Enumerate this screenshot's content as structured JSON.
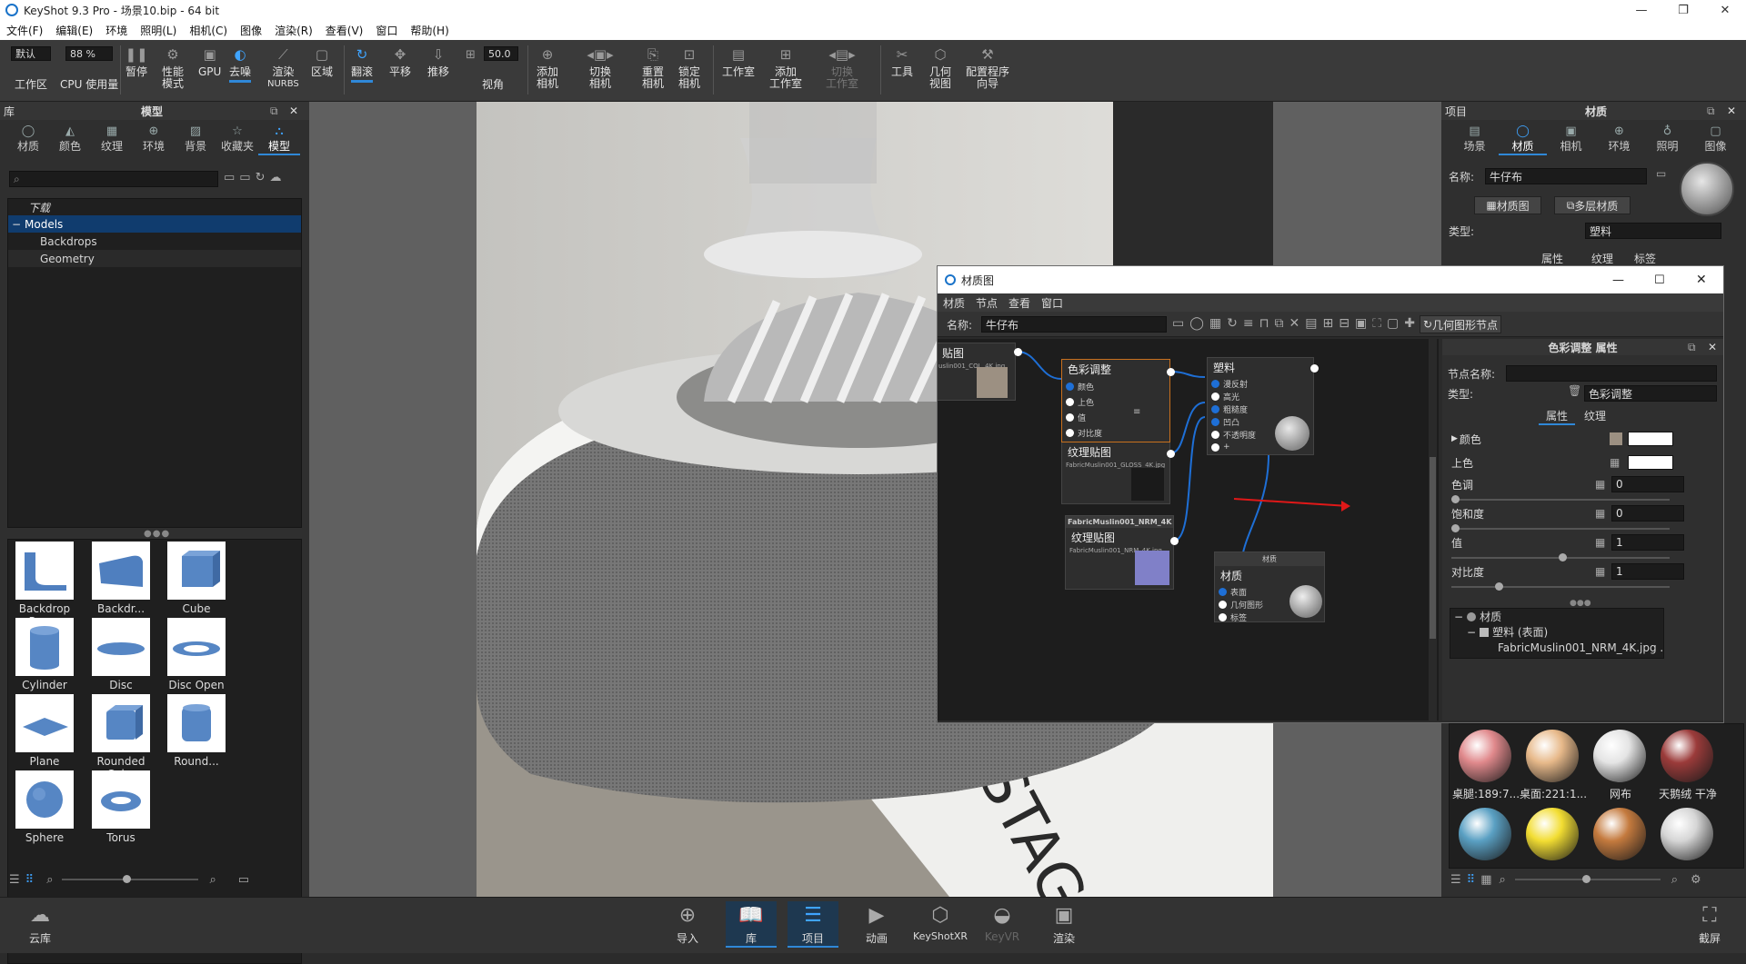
{
  "titlebar": {
    "title": "KeyShot 9.3 Pro  - 场景10.bip  - 64 bit",
    "min": "—",
    "restore": "❐",
    "close": "✕"
  },
  "menubar": [
    "文件(F)",
    "编辑(E)",
    "环境",
    "照明(L)",
    "相机(C)",
    "图像",
    "渲染(R)",
    "查看(V)",
    "窗口",
    "帮助(H)"
  ],
  "ribbon": {
    "workspace_select": "默认",
    "workspace_label": "工作区",
    "cpu_value": "88 %",
    "cpu_label": "CPU 使用量",
    "pause": "暂停",
    "perf_line1": "性能",
    "perf_line2": "模式",
    "gpu": "GPU",
    "denoise": "去噪",
    "nurbs_line1": "渲染",
    "nurbs_line2": "NURBS",
    "region": "区域",
    "tumble": "翻滚",
    "pan": "平移",
    "dolly": "推移",
    "fov_value": "50.0",
    "fov_label": "视角",
    "add_cam_1": "添加",
    "add_cam_2": "相机",
    "switch_cam_1": "切换",
    "switch_cam_2": "相机",
    "reset_cam_1": "重置",
    "reset_cam_2": "相机",
    "lock_cam_1": "锁定",
    "lock_cam_2": "相机",
    "studio": "工作室",
    "add_studio_1": "添加",
    "add_studio_2": "工作室",
    "switch_studio_1": "切换",
    "switch_studio_2": "工作室",
    "tools": "工具",
    "geo_view_1": "几何",
    "geo_view_2": "视图",
    "wizard_1": "配置程序",
    "wizard_2": "向导"
  },
  "library": {
    "header_left": "库",
    "header_title": "模型",
    "tabs": [
      "材质",
      "颜色",
      "纹理",
      "环境",
      "背景",
      "收藏夹",
      "模型"
    ],
    "tree": {
      "download": "下载",
      "models": "Models",
      "backdrops": "Backdrops",
      "geometry": "Geometry"
    },
    "items": [
      "Backdrop Ramp",
      "Backdr...",
      "Cube",
      "Cylinder",
      "Disc",
      "Disc Open",
      "Plane",
      "Rounded Cube",
      "Round...",
      "Sphere",
      "Torus"
    ]
  },
  "project": {
    "header_left": "项目",
    "header_title": "材质",
    "tabs": [
      "场景",
      "材质",
      "相机",
      "环境",
      "照明",
      "图像"
    ],
    "name_label": "名称:",
    "name_value": "牛仔布",
    "graph_btn": "材质图",
    "multi_btn": "多层材质",
    "type_label": "类型:",
    "type_value": "塑料",
    "subtabs": [
      "属性",
      "纹理",
      "标签"
    ],
    "lib_items": [
      "桌腿:189:7...",
      "桌面:221:1...",
      "网布",
      "天鹅绒 干净"
    ],
    "colors": {
      "ball1": "#e0898c",
      "ball2": "#e7b98a",
      "ball3": "#e4e4e4",
      "ball4": "#9b3b3a",
      "ball5": "#5aa0c3",
      "ball6": "#f2dd32",
      "ball7": "#c47a3e",
      "ball8": "#d6d6d6"
    }
  },
  "matgraph": {
    "title": "材质图",
    "menu": [
      "材质",
      "节点",
      "查看",
      "窗口"
    ],
    "name_label": "名称:",
    "name_value": "牛仔布",
    "geo_node_btn": "几何图形节点",
    "nodes": {
      "tex_partial_title": "贴图",
      "tex_partial_file": "uslin001_COL_4K.jpg",
      "cc_title": "色彩调整",
      "cc_pins": [
        "颜色",
        "上色",
        "值",
        "对比度",
        "+"
      ],
      "plastic_title": "塑料",
      "plastic_pins": [
        "漫反射",
        "高光",
        "粗糙度",
        "凹凸",
        "不透明度",
        "+"
      ],
      "tex2_title": "纹理贴图",
      "tex2_file": "FabricMuslin001_GLOSS_4K.jpg",
      "nrm_header": "FabricMuslin001_NRM_4K",
      "tex3_title": "纹理贴图",
      "tex3_file": "FabricMuslin001_NRM_4K.jpg",
      "mat_header": "材质",
      "mat_title": "材质",
      "mat_pins": [
        "表面",
        "几何图形",
        "标签"
      ]
    },
    "props": {
      "title": "色彩调整  属性",
      "node_name_label": "节点名称:",
      "type_label": "类型:",
      "type_value": "色彩调整",
      "tabs": [
        "属性",
        "纹理"
      ],
      "color_label": "颜色",
      "tint_label": "上色",
      "hue_label": "色调",
      "hue_value": "0",
      "sat_label": "饱和度",
      "sat_value": "0",
      "val_label": "值",
      "val_value": "1",
      "contrast_label": "对比度",
      "contrast_value": "1",
      "tree": [
        "材质",
        "塑料 (表面)",
        "FabricMuslin001_NRM_4K.jpg ..."
      ]
    }
  },
  "scene_text": "STAGE",
  "bottom": [
    "云库",
    "导入",
    "库",
    "项目",
    "动画",
    "KeyShotXR",
    "KeyVR",
    "渲染",
    "截屏"
  ]
}
